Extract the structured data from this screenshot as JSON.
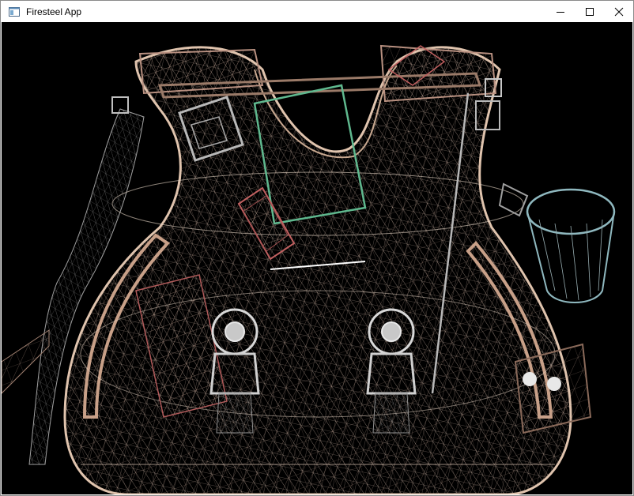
{
  "window": {
    "title": "Firesteel App",
    "icon": "app-window-icon",
    "controls": {
      "minimize": "minimize-icon",
      "maximize": "maximize-icon",
      "close": "close-icon"
    }
  },
  "viewport": {
    "background": "#000000",
    "render_mode": "wireframe",
    "subject": "guitar-body-mesh",
    "colors": {
      "body": "#d8b8a0",
      "body_dark": "#9a7a68",
      "metal": "#b8b8b8",
      "teal": "#5fb88e",
      "red": "#c06060",
      "cup": "#8fb8bf"
    }
  }
}
